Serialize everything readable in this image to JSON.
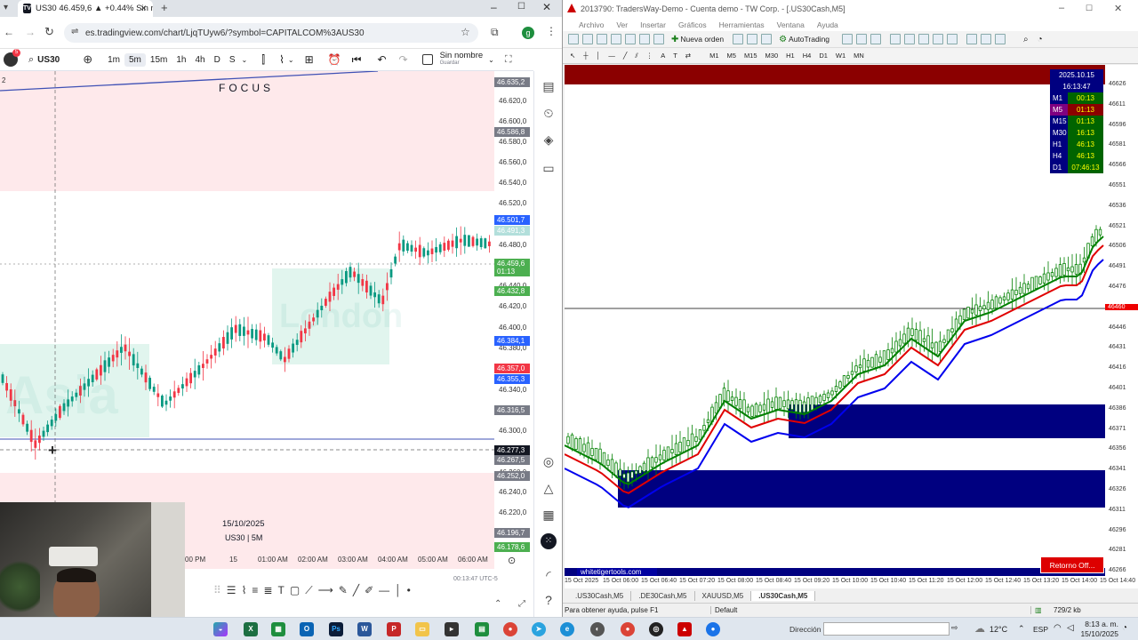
{
  "browser": {
    "tab_title": "US30 46.459,6 ▲ +0.44% Sin no",
    "tab_close": "×",
    "new_tab": "+",
    "url": "es.tradingview.com/chart/LjqTUyw6/?symbol=CAPITALCOM%3AUS30",
    "profile_initial": "g"
  },
  "tv": {
    "symbol": "US30",
    "avatar_badge": "5",
    "timeframes": [
      "1m",
      "5m",
      "15m",
      "1h",
      "4h",
      "D",
      "S"
    ],
    "active_timeframe": "5m",
    "layout_name": "Sin nombre",
    "layout_saved": "Guardar",
    "panel_number": "2",
    "watermark_focus": "FOCUS",
    "watermark_london": "London",
    "watermark_asia": "Asia",
    "date_label": "15/10/2025",
    "symbol_tf_label": "US30 | 5M",
    "time_labels": [
      "00 PM",
      "15",
      "01:00 AM",
      "02:00 AM",
      "03:00 AM",
      "04:00 AM",
      "05:00 AM",
      "06:00 AM"
    ],
    "price_labels": [
      "46.620,0",
      "46.600,0",
      "46.580,0",
      "46.560,0",
      "46.540,0",
      "46.520,0",
      "46.480,0",
      "46.440,0",
      "46.420,0",
      "46.400,0",
      "46.380,0",
      "46.340,0",
      "46.320,0",
      "46.300,0",
      "46.260,0",
      "46.240,0",
      "46.220,0"
    ],
    "price_tags": [
      {
        "text": "46.635,2",
        "bg": "#787b86"
      },
      {
        "text": "46.586,8",
        "bg": "#787b86"
      },
      {
        "text": "46.501,7",
        "bg": "#2962ff"
      },
      {
        "text": "46.491,3",
        "bg": "#b2dfdb"
      },
      {
        "text": "46.459,6",
        "bg": "#4caf50"
      },
      {
        "text": "01:13",
        "bg": "#4caf50"
      },
      {
        "text": "46.432,8",
        "bg": "#4caf50"
      },
      {
        "text": "46.384,1",
        "bg": "#2962ff"
      },
      {
        "text": "46.357,0",
        "bg": "#f23645"
      },
      {
        "text": "46.355,3",
        "bg": "#2962ff"
      },
      {
        "text": "46.316,5",
        "bg": "#787b86"
      },
      {
        "text": "46.277,3",
        "bg": "#131722"
      },
      {
        "text": "46.267,5",
        "bg": "#787b86"
      },
      {
        "text": "46.252,0",
        "bg": "#787b86"
      },
      {
        "text": "46.196,7",
        "bg": "#787b86"
      },
      {
        "text": "46.178,6",
        "bg": "#4caf50"
      }
    ],
    "timezone_label": "00:13:47 UTC-5"
  },
  "mt4": {
    "title": "2013790: TradersWay-Demo - Cuenta demo - TW Corp. - [.US30Cash,M5]",
    "menu": [
      "Archivo",
      "Ver",
      "Insertar",
      "Gráficos",
      "Herramientas",
      "Ventana",
      "Ayuda"
    ],
    "new_order": "Nueva orden",
    "autotrading": "AutoTrading",
    "periods": [
      "M1",
      "M5",
      "M15",
      "M30",
      "H1",
      "H4",
      "D1",
      "W1",
      "MN"
    ],
    "timeframe_panel": {
      "date": "2025.10.15",
      "time": "16:13:47",
      "rows": [
        {
          "tf": "M1",
          "val": "00:13",
          "tfbg": "#000080",
          "valbg": "#006400"
        },
        {
          "tf": "M5",
          "val": "01:13",
          "tfbg": "#800080",
          "valbg": "#8b0000"
        },
        {
          "tf": "M15",
          "val": "01:13",
          "tfbg": "#000080",
          "valbg": "#006400"
        },
        {
          "tf": "M30",
          "val": "16:13",
          "tfbg": "#000080",
          "valbg": "#006400"
        },
        {
          "tf": "H1",
          "val": "46:13",
          "tfbg": "#000080",
          "valbg": "#006400"
        },
        {
          "tf": "H4",
          "val": "46:13",
          "tfbg": "#000080",
          "valbg": "#006400"
        },
        {
          "tf": "D1",
          "val": "07:46:13",
          "tfbg": "#000080",
          "valbg": "#006400"
        }
      ]
    },
    "price_labels": [
      "46626",
      "46611",
      "46596",
      "46581",
      "46566",
      "46551",
      "46536",
      "46521",
      "46506",
      "46491",
      "46476",
      "46461",
      "46446",
      "46431",
      "46416",
      "46401",
      "46386",
      "46371",
      "46356",
      "46341",
      "46326",
      "46311",
      "46296",
      "46281",
      "46266"
    ],
    "current_price": "46460",
    "watermark": "whitetigertools.com",
    "retorno_button": "Retorno Off...",
    "time_labels": [
      "15 Oct 2025",
      "15 Oct 06:00",
      "15 Oct 06:40",
      "15 Oct 07:20",
      "15 Oct 08:00",
      "15 Oct 08:40",
      "15 Oct 09:20",
      "15 Oct 10:00",
      "15 Oct 10:40",
      "15 Oct 11:20",
      "15 Oct 12:00",
      "15 Oct 12:40",
      "15 Oct 13:20",
      "15 Oct 14:00",
      "15 Oct 14:40"
    ],
    "symbol_tabs": [
      ".US30Cash,M5",
      ".DE30Cash,M5",
      "XAUUSD,M5",
      ".US30Cash,M5"
    ],
    "active_tab_index": 3,
    "status_help": "Para obtener ayuda, pulse F1",
    "status_profile": "Default",
    "status_traffic": "729/2 kb"
  },
  "taskbar": {
    "direccion_label": "Dirección",
    "temperature": "12°C",
    "language": "ESP",
    "clock_time": "8:13 a. m.",
    "clock_date": "15/10/2025"
  },
  "colors": {
    "accent": "#2962ff",
    "bull": "#089981",
    "bear": "#f23645",
    "mt_bar": "#00a000"
  }
}
